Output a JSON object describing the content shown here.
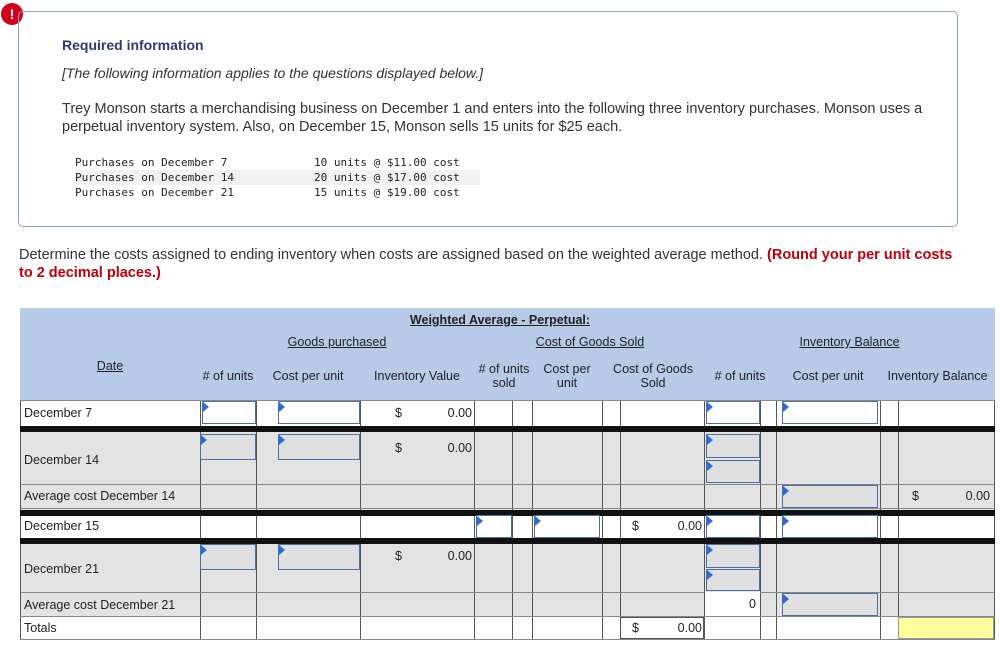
{
  "alert": {
    "glyph": "!"
  },
  "required": {
    "title": "Required information",
    "note": "[The following information applies to the questions displayed below.]",
    "body": "Trey Monson starts a merchandising business on December 1 and enters into the following three inventory purchases. Monson uses a perpetual inventory system. Also, on December 15, Monson sells 15 units for $25 each.",
    "purchases": [
      {
        "label": "Purchases on December 7",
        "detail": "10 units @ $11.00 cost"
      },
      {
        "label": "Purchases on December 14",
        "detail": "20 units @ $17.00 cost"
      },
      {
        "label": "Purchases on December 21",
        "detail": "15 units @ $19.00 cost"
      }
    ]
  },
  "question": {
    "text": "Determine the costs assigned to ending inventory when costs are assigned based on the weighted average method.",
    "emphasis": "(Round your per unit costs to 2 decimal places.)"
  },
  "table": {
    "title": "Weighted Average - Perpetual:",
    "groups": {
      "goods": "Goods purchased",
      "cogs": "Cost of Goods Sold",
      "balance": "Inventory Balance"
    },
    "columns": {
      "date": "Date",
      "units": "# of units",
      "cost_per_unit": "Cost per unit",
      "inventory_value": "Inventory Value",
      "units_sold": "# of units sold",
      "cost_per_unit_sold": "Cost per unit",
      "cost_of_goods_sold": "Cost of Goods Sold",
      "bal_units": "# of units",
      "bal_cost_per_unit": "Cost per unit",
      "inventory_balance": "Inventory Balance"
    },
    "rows": {
      "dec7": "December 7",
      "dec14": "December 14",
      "avg14": "Average cost December 14",
      "dec15": "December 15",
      "dec21": "December 21",
      "avg21": "Average cost December 21",
      "totals": "Totals"
    },
    "dollar": "$",
    "values": {
      "dec7_value": "0.00",
      "dec14_value": "0.00",
      "avg14_balance": "0.00",
      "dec15_cogs": "0.00",
      "dec21_value": "0.00",
      "avg21_units": "0",
      "totals_cogs": "0.00"
    }
  }
}
